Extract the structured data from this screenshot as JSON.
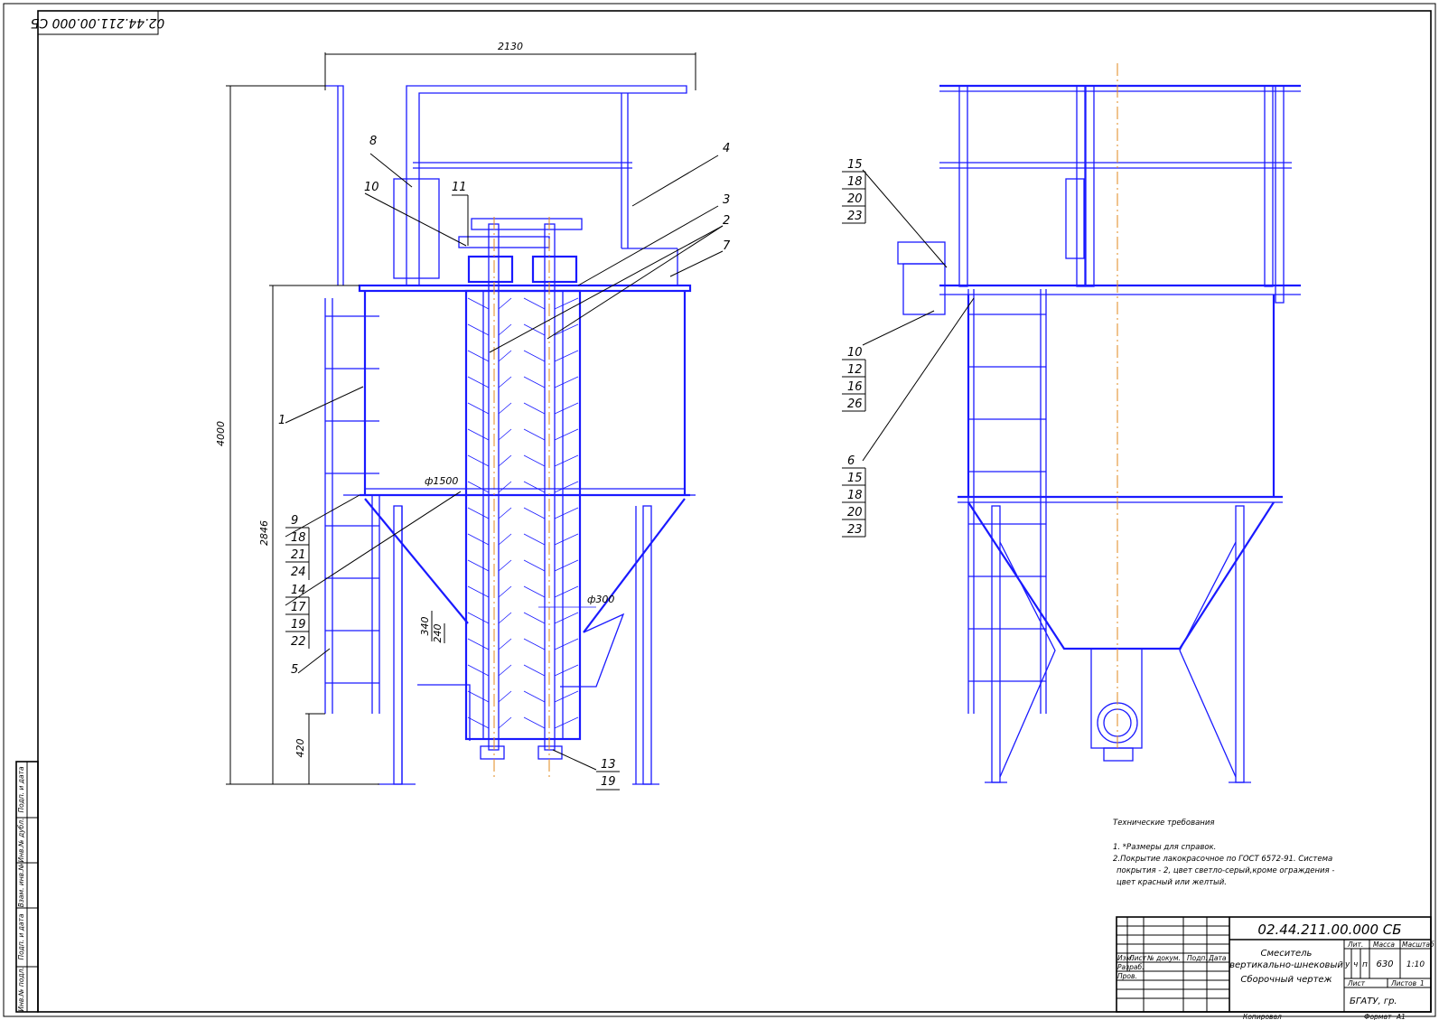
{
  "drawing": {
    "designation_stamp": "02.44.211.00.000 СБ",
    "dimensions": {
      "width_total": "2130",
      "height_total": "4000",
      "height_body": "2846",
      "leg_height": "420",
      "diameter_body": "ф1500",
      "diameter_screw": "ф300",
      "pitch_a": "340",
      "pitch_b": "240"
    },
    "callouts_left": [
      "1",
      "2",
      "3",
      "4",
      "5",
      "7",
      "8",
      "10",
      "11"
    ],
    "callout_stack_9": [
      "9",
      "18",
      "21",
      "24"
    ],
    "callout_stack_14": [
      "14",
      "17",
      "19",
      "22"
    ],
    "callout_stack_13": [
      "13",
      "19"
    ],
    "callout_stack_15": [
      "15",
      "18",
      "20",
      "23"
    ],
    "callout_stack_10": [
      "10",
      "12",
      "16",
      "26"
    ],
    "callout_stack_6": [
      "6",
      "15",
      "18",
      "20",
      "23"
    ],
    "tech_requirements": {
      "title": "Технические требования",
      "line1": "1. *Размеры для справок.",
      "line2": "2.Покрытие лакокрасочное по ГОСТ 6572-91. Система",
      "line3": "покрытия - 2, цвет светло-серый,кроме ограждения -",
      "line4": "цвет красный или желтый."
    },
    "side_stamp": [
      "Подп. и дата",
      "Инв.№ дубл.",
      "Взам. инв.№",
      "Подп. и дата",
      "Инв.№ подл."
    ]
  },
  "title_block": {
    "designation": "02.44.211.00.000 СБ",
    "name_line1": "Смеситель",
    "name_line2": "вертикально-шнековый",
    "name_line3": "Сборочный чертеж",
    "col_izm": "Изм.",
    "col_list": "Лист",
    "col_doc": "№ докум.",
    "col_sign": "Подп.",
    "col_date": "Дата",
    "row_razrab": "Разраб.",
    "row_prov": "Пров.",
    "lit_label": "Лит.",
    "mass_label": "Масса",
    "scale_label": "Масштаб",
    "lit_u": "у",
    "lit_ch": "ч",
    "lit_p": "п",
    "mass": "630",
    "scale": "1:10",
    "sheet_label": "Лист",
    "sheets_label": "Листов",
    "sheets": "1",
    "org": "БГАТУ, гр.",
    "copied": "Копировал",
    "format": "Формат",
    "format_value": "А1"
  }
}
